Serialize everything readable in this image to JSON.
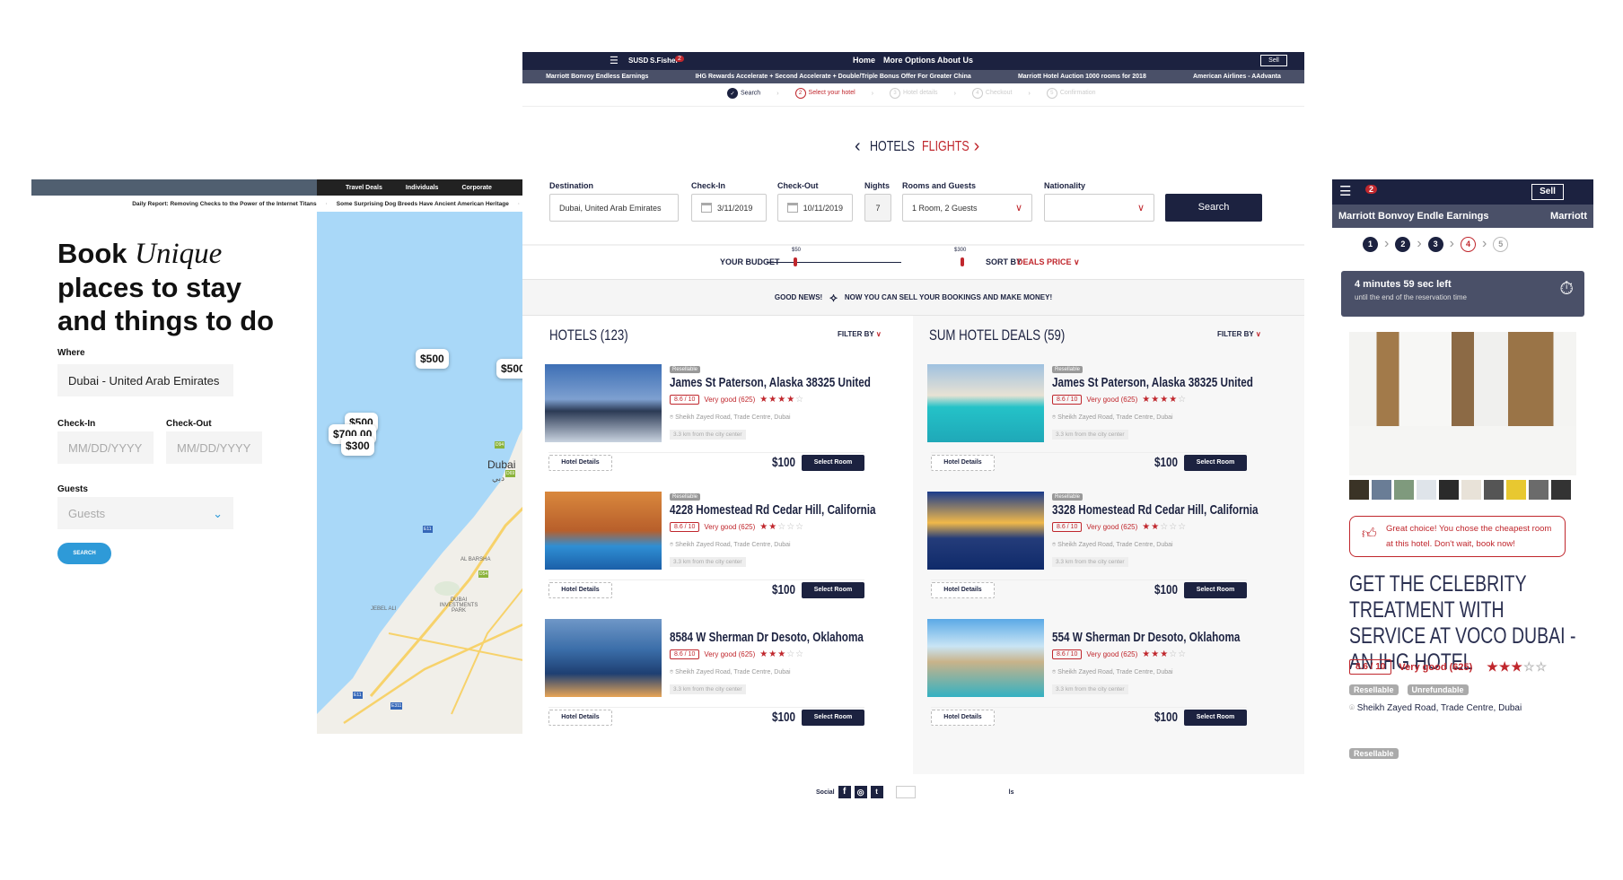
{
  "left": {
    "topnav": [
      "Travel Deals",
      "Individuals",
      "Corporate"
    ],
    "ticker": [
      "Daily Report: Removing Checks to the Power of the Internet Titans",
      "Some Surprising Dog Breeds Have Ancient American Heritage"
    ],
    "heading_1": "Book",
    "heading_em": "Unique",
    "heading_2": "places to stay and things to do",
    "where_label": "Where",
    "where_value": "Dubai - United Arab Emirates",
    "checkin_label": "Check-In",
    "checkin_placeholder": "MM/DD/YYYY",
    "checkout_label": "Check-Out",
    "checkout_placeholder": "MM/DD/YYYY",
    "guests_label": "Guests",
    "guests_placeholder": "Guests",
    "search_label": "SEARCH",
    "map": {
      "labels": {
        "city": "Dubai",
        "city_ar": "دبي",
        "area1": "AL BARSHA",
        "area2": "DUBAI INVESTMENTS PARK",
        "area3": "JEBEL ALI",
        "roads": [
          "D94",
          "E11",
          "D54",
          "E11",
          "E311",
          "D69"
        ]
      },
      "pins": [
        "$500",
        "$500",
        "$500",
        "$700.00",
        "$300"
      ]
    }
  },
  "center": {
    "nav": {
      "brand": "SUSD",
      "user": "S.Fisher",
      "notifications": "2",
      "links": [
        "Home",
        "More Options",
        "About Us"
      ],
      "sell": "Sell"
    },
    "ticker": [
      "Marriott Bonvoy Endless Earnings",
      "IHG Rewards Accelerate + Second Accelerate + Double/Triple Bonus Offer For Greater China",
      "Marriott Hotel Auction 1000 rooms for 2018",
      "American Airlines - AAdvanta"
    ],
    "steps": [
      {
        "n": "✓",
        "label": "Search",
        "state": "done"
      },
      {
        "n": "2",
        "label": "Select your hotel",
        "state": "active"
      },
      {
        "n": "3",
        "label": "Hotel details",
        "state": "todo"
      },
      {
        "n": "4",
        "label": "Checkout",
        "state": "todo"
      },
      {
        "n": "5",
        "label": "Confirmation",
        "state": "todo"
      }
    ],
    "mode_tabs": {
      "hotels": "HOTELS",
      "flights": "FLIGHTS"
    },
    "form": {
      "destination_label": "Destination",
      "destination": "Dubai, United Arab Emirates",
      "checkin_label": "Check-In",
      "checkin": "3/11/2019",
      "checkout_label": "Check-Out",
      "checkout": "10/11/2019",
      "nights_label": "Nights",
      "nights": "7",
      "rooms_label": "Rooms and Guests",
      "rooms": "1 Room, 2 Guests",
      "nationality_label": "Nationality",
      "nationality": "",
      "search": "Search"
    },
    "budget": {
      "label": "YOUR BUDGET",
      "min": "$50",
      "max": "$300",
      "sort_label": "SORT BY",
      "sort_value": "DEALS PRICE"
    },
    "banner": {
      "left": "GOOD NEWS!",
      "right": "NOW YOU CAN SELL YOUR BOOKINGS AND MAKE MONEY!"
    },
    "hotels": {
      "heading": "HOTELS (123)",
      "filter": "FILTER BY",
      "cards": [
        {
          "badge": "Resellable",
          "title": "James St Paterson, Alaska 38325 United",
          "score": "8.6 / 10",
          "review": "Very good (625)",
          "stars": 4,
          "address": "Sheikh Zayed Road, Trade Centre, Dubai",
          "distance": "3.3 km from the city center",
          "details": "Hotel Details",
          "price": "$100",
          "select": "Select Room"
        },
        {
          "badge": "Resellable",
          "title": "4228 Homestead Rd Cedar Hill, California",
          "score": "8.6 / 10",
          "review": "Very good (625)",
          "stars": 2,
          "address": "Sheikh Zayed Road, Trade Centre, Dubai",
          "distance": "3.3 km from the city center",
          "details": "Hotel Details",
          "price": "$100",
          "select": "Select Room"
        },
        {
          "badge": "",
          "title": "8584 W Sherman Dr Desoto, Oklahoma",
          "score": "8.6 / 10",
          "review": "Very good (625)",
          "stars": 3,
          "address": "Sheikh Zayed Road, Trade Centre, Dubai",
          "distance": "3.3 km from the city center",
          "details": "Hotel Details",
          "price": "$100",
          "select": "Select Room"
        }
      ]
    },
    "deals": {
      "heading": "SUM HOTEL DEALS (59)",
      "filter": "FILTER BY",
      "cards": [
        {
          "badge": "Resellable",
          "title": "James St Paterson, Alaska 38325 United",
          "score": "8.6 / 10",
          "review": "Very good (625)",
          "stars": 4,
          "address": "Sheikh Zayed Road, Trade Centre, Dubai",
          "distance": "3.3 km from the city center",
          "details": "Hotel Details",
          "price": "$100",
          "select": "Select Room"
        },
        {
          "badge": "Resellable",
          "title": "3328 Homestead Rd Cedar Hill, California",
          "score": "8.6 / 10",
          "review": "Very good (625)",
          "stars": 2,
          "address": "Sheikh Zayed Road, Trade Centre, Dubai",
          "distance": "3.3 km from the city center",
          "details": "Hotel Details",
          "price": "$100",
          "select": "Select Room"
        },
        {
          "badge": "",
          "title": "554 W Sherman Dr Desoto, Oklahoma",
          "score": "8.6 / 10",
          "review": "Very good (625)",
          "stars": 3,
          "address": "Sheikh Zayed Road, Trade Centre, Dubai",
          "distance": "3.3 km from the city center",
          "details": "Hotel Details",
          "price": "$100",
          "select": "Select Room"
        }
      ]
    },
    "footer": {
      "social": "Social",
      "trailing": "ls"
    }
  },
  "right": {
    "notifications": "2",
    "sell": "Sell",
    "ticker": [
      "Marriott Bonvoy Endle Earnings",
      "Marriott"
    ],
    "steps": [
      "1",
      "2",
      "3",
      "4",
      "5"
    ],
    "timer": {
      "title": "4 minutes 59 sec left",
      "subtitle": "until the end of the reservation time"
    },
    "notice": "Great choice! You chose the cheapest room at this hotel. Don't wait, book now!",
    "heading": "GET THE CELEBRITY TREATMENT WITH SERVICE AT VOCO DUBAI - AN IHG HOTEL",
    "score": "8.6 / 10",
    "review": "Very good (625)",
    "stars": 3,
    "tags": [
      "Resellable",
      "Unrefundable"
    ],
    "address": "Sheikh Zayed Road, Trade Centre, Dubai",
    "tag_bottom": "Resellable"
  },
  "colors": {
    "navy": "#1c2240",
    "slate": "#4a5068",
    "accent": "#c0272d",
    "map_blue": "#2e9ad8"
  }
}
